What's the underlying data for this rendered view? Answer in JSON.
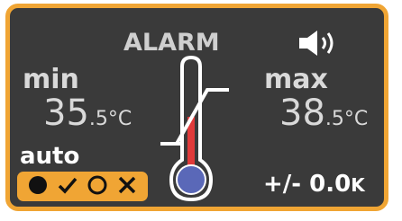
{
  "alarm": {
    "title": "ALARM",
    "min": {
      "label": "min",
      "value_int": "35",
      "value_dec": ".5",
      "unit": "°C"
    },
    "max": {
      "label": "max",
      "value_int": "38",
      "value_dec": ".5",
      "unit": "°C"
    },
    "auto": {
      "label": "auto",
      "icons": [
        "filled-circle-icon",
        "checkmark-icon",
        "hollow-circle-icon",
        "cross-icon"
      ]
    },
    "tolerance": {
      "prefix": "+/- ",
      "value": "0.0",
      "unit": "K"
    },
    "speaker_icon": "speaker-on-icon",
    "thermometer_icon": "thermometer-icon"
  },
  "colors": {
    "border": "#f0a534",
    "background": "#3a3a3a",
    "text": "#d9d9d9",
    "accent_red": "#e03a3a",
    "bulb": "#5a68b8"
  }
}
